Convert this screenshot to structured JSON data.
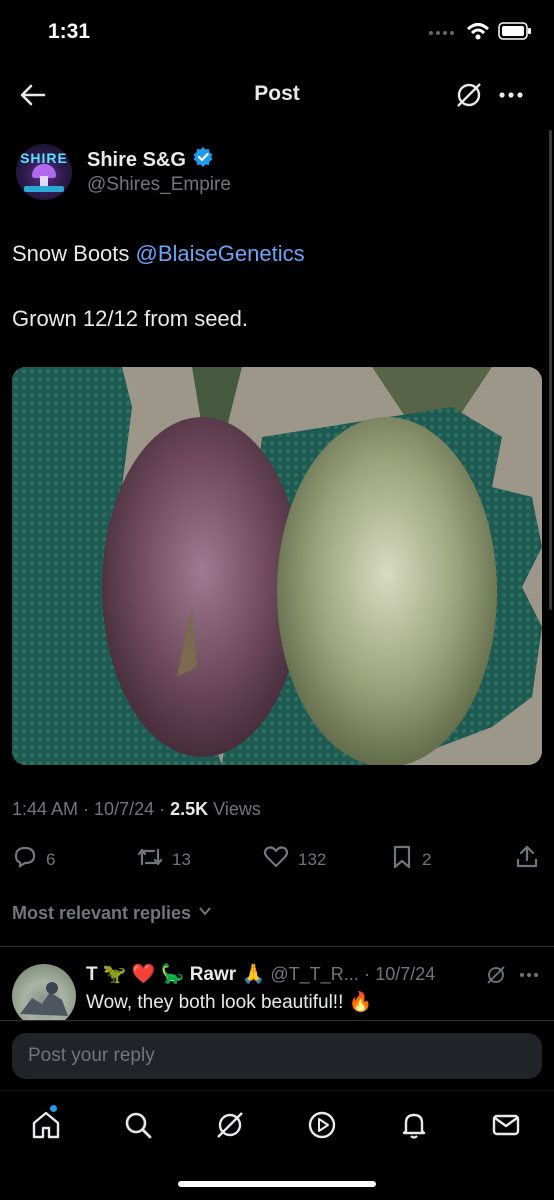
{
  "status": {
    "time": "1:31"
  },
  "nav": {
    "title": "Post"
  },
  "post": {
    "author_name": "Shire S&G",
    "author_handle": "@Shires_Empire",
    "avatar_text": "SHIRE",
    "text_prefix": "Snow Boots ",
    "mention": "@BlaiseGenetics",
    "text_line2": "Grown 12/12 from seed.",
    "time": "1:44 AM",
    "date": "10/7/24",
    "views_count": "2.5K",
    "views_label": "Views"
  },
  "actions": {
    "replies": "6",
    "reposts": "13",
    "likes": "132",
    "bookmarks": "2"
  },
  "replies_filter": "Most relevant replies",
  "reply": {
    "name_start": "T",
    "name_end": "Rawr",
    "handle": "@T_T_R...",
    "date": "10/7/24",
    "text": "Wow, they both look beautiful!! 🔥",
    "emojis": "🦖 ❤️ 🦕",
    "emoji_end": "🙏"
  },
  "composer": {
    "placeholder": "Post your reply"
  },
  "colors": {
    "accent": "#1d9bf0",
    "mention": "#6ba4f8",
    "muted": "#71767b",
    "text": "#e7e9ea"
  },
  "icons": [
    "back-arrow-icon",
    "grok-icon",
    "more-icon",
    "verified-badge-icon",
    "reply-icon",
    "repost-icon",
    "like-icon",
    "bookmark-icon",
    "share-icon",
    "chevron-down-icon",
    "home-icon",
    "search-icon",
    "play-icon",
    "bell-icon",
    "mail-icon"
  ]
}
